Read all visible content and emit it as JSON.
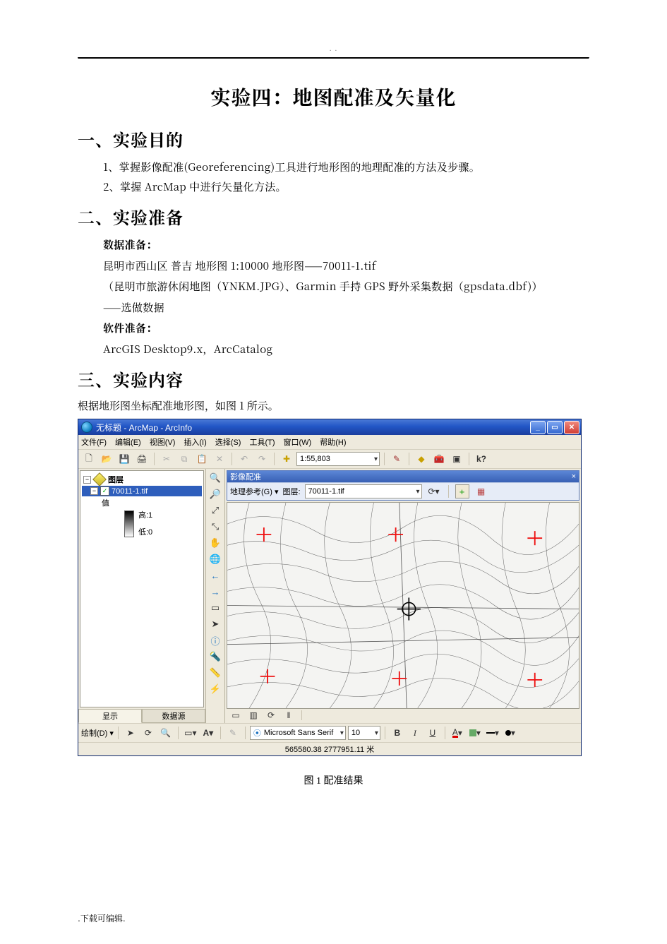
{
  "header_dots": ". .",
  "title": "实验四：地图配准及矢量化",
  "sections": {
    "s1": {
      "heading": "一、实验目的",
      "items": [
        "1、掌握影像配准(Georeferencing)工具进行地形图的地理配准的方法及步骤。",
        "2、掌握 ArcMap 中进行矢量化方法。"
      ]
    },
    "s2": {
      "heading": "二、实验准备",
      "data_label": "数据准备：",
      "data_line1": "昆明市西山区 普吉 地形图 1:10000 地形图——70011-1.tif",
      "data_line2": "（昆明市旅游休闲地图（YNKM.JPG）、Garmin 手持 GPS 野外采集数据（gpsdata.dbf)）",
      "data_line3": "——选做数据",
      "soft_label": "软件准备：",
      "soft_line": "ArcGIS Desktop9.x，ArcCatalog"
    },
    "s3": {
      "heading": "三、实验内容",
      "intro": "根据地形图坐标配准地形图，如图 1 所示。"
    }
  },
  "arcmap": {
    "window_title": "无标题 - ArcMap - ArcInfo",
    "menus": [
      "文件(F)",
      "编辑(E)",
      "视图(V)",
      "插入(I)",
      "选择(S)",
      "工具(T)",
      "窗口(W)",
      "帮助(H)"
    ],
    "scale": "1:55,803",
    "toc": {
      "root": "图层",
      "layer": "70011-1.tif",
      "value_label": "值",
      "high": "高:1",
      "low": "低:0",
      "tab_display": "显示",
      "tab_source": "数据源"
    },
    "georef": {
      "title": "影像配准",
      "geo_ref": "地理参考(G)",
      "layer_label": "图层:",
      "layer_value": "70011-1.tif"
    },
    "drawbar": {
      "label": "绘制(D)",
      "font": "Microsoft Sans Serif",
      "size": "10",
      "bold": "B",
      "italic": "I",
      "underline": "U"
    },
    "status_coords": "565580.38  2777951.11 米"
  },
  "fig_caption": "图 1 配准结果",
  "footer": ".下载可编辑."
}
